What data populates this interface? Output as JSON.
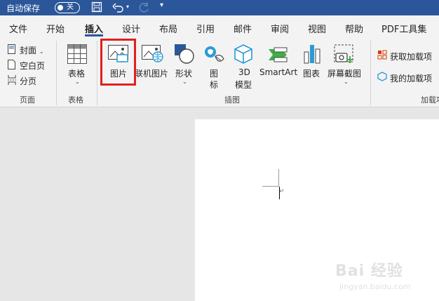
{
  "titlebar": {
    "autosave_label": "自动保存",
    "autosave_state": "关",
    "more_symbol": "▾"
  },
  "tabs": [
    {
      "label": "文件"
    },
    {
      "label": "开始"
    },
    {
      "label": "插入"
    },
    {
      "label": "设计"
    },
    {
      "label": "布局"
    },
    {
      "label": "引用"
    },
    {
      "label": "邮件"
    },
    {
      "label": "审阅"
    },
    {
      "label": "视图"
    },
    {
      "label": "帮助"
    },
    {
      "label": "PDF工具集"
    }
  ],
  "ribbon": {
    "pages_group": {
      "label": "页面",
      "cover": "封面",
      "blank": "空白页",
      "break": "分页"
    },
    "table_group": {
      "label": "表格",
      "table": "表格"
    },
    "illustrations_group": {
      "label": "插图",
      "picture": "图片",
      "online_picture": "联机图片",
      "shapes": "形状",
      "icons_line1": "图",
      "icons_line2": "标",
      "model_line1": "3D",
      "model_line2": "模型",
      "smartart": "SmartArt",
      "chart": "图表",
      "screenshot": "屏幕截图"
    },
    "addins_group": {
      "label": "加载项",
      "get": "获取加载项",
      "mine": "我的加载项"
    },
    "caret": "⌄"
  },
  "watermark": {
    "text": "Bai 经验",
    "url": "jingyan.baidu.com"
  },
  "colors": {
    "titlebar": "#2b579a",
    "highlight": "#e02020",
    "ribbon": "#f3f3f3",
    "workspace": "#e6e6e6"
  }
}
